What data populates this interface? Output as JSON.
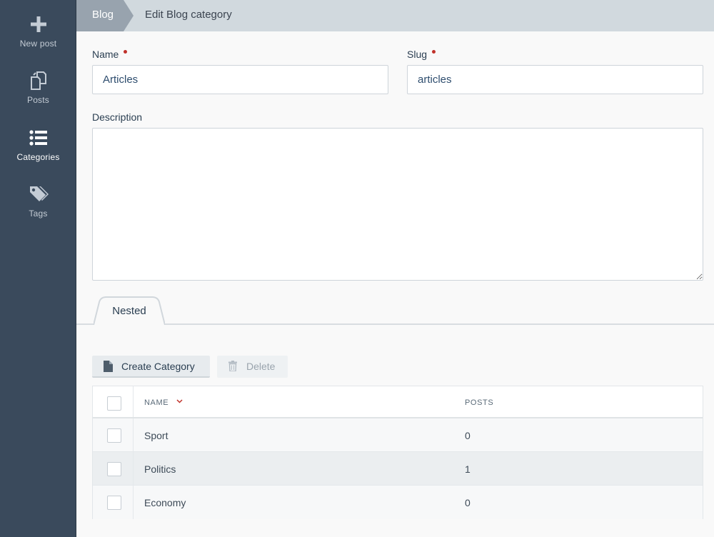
{
  "sidebar": {
    "items": [
      {
        "label": "New post",
        "icon": "plus-icon"
      },
      {
        "label": "Posts",
        "icon": "posts-icon"
      },
      {
        "label": "Categories",
        "icon": "list-icon",
        "active": true
      },
      {
        "label": "Tags",
        "icon": "tags-icon"
      }
    ]
  },
  "breadcrumb": {
    "root": "Blog",
    "current": "Edit Blog category"
  },
  "form": {
    "name_label": "Name",
    "name_value": "Articles",
    "slug_label": "Slug",
    "slug_value": "articles",
    "description_label": "Description",
    "description_value": ""
  },
  "tabs": [
    {
      "label": "Nested",
      "active": true
    }
  ],
  "toolbar": {
    "create_label": "Create Category",
    "delete_label": "Delete"
  },
  "table": {
    "columns": [
      "NAME",
      "POSTS"
    ],
    "rows": [
      {
        "name": "Sport",
        "posts": "0"
      },
      {
        "name": "Politics",
        "posts": "1"
      },
      {
        "name": "Economy",
        "posts": "0"
      }
    ]
  },
  "colors": {
    "sidebar_bg": "#3a4a5c",
    "topbar_bg": "#d1d9de",
    "breadcrumb_root_bg": "#98a3ae",
    "required_dot": "#c0312a",
    "input_text": "#2e4d6e"
  }
}
